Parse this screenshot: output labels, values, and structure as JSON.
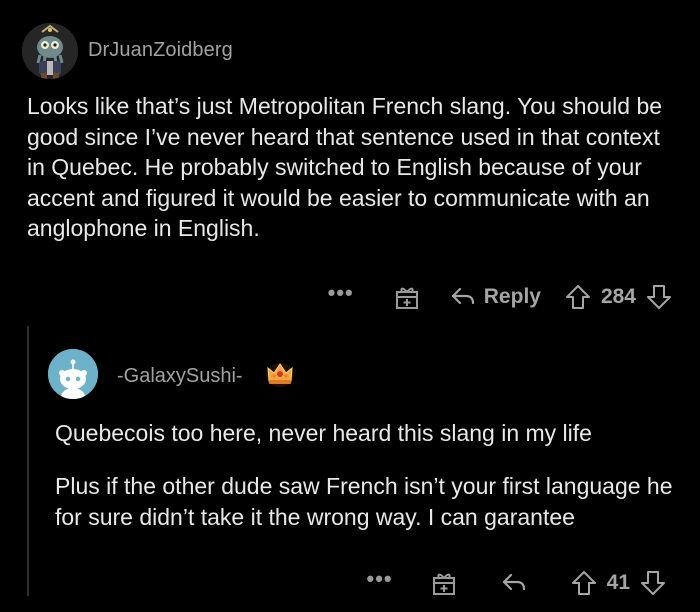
{
  "comments": [
    {
      "username": "DrJuanZoidberg",
      "body": "Looks like that’s just Metropolitan French slang. You should be good since I’ve never heard that sentence used in that context in Quebec. He probably switched to English because of your accent and figured it would be easier to communicate with an anglophone in English.",
      "actions": {
        "more": "•••",
        "reply_label": "Reply",
        "score": "284"
      }
    },
    {
      "username": "-GalaxySushi-",
      "body_paragraphs": [
        "Quebecois too here, never heard this slang in my life",
        "Plus if the other dude saw French isn’t your first language he for sure didn’t take it the wrong way. I can garantee"
      ],
      "actions": {
        "more": "•••",
        "score": "41"
      }
    }
  ],
  "colors": {
    "background": "#000000",
    "text": "#e8e8e8",
    "muted": "#9a9a9a",
    "thread_line": "#2e2e2e",
    "avatar2": "#6cb3c9"
  },
  "icons": [
    "avatar-zoidberg",
    "award-icon",
    "reply-arrow-icon",
    "upvote-icon",
    "downvote-icon",
    "crown-award-icon",
    "snoo-avatar"
  ]
}
